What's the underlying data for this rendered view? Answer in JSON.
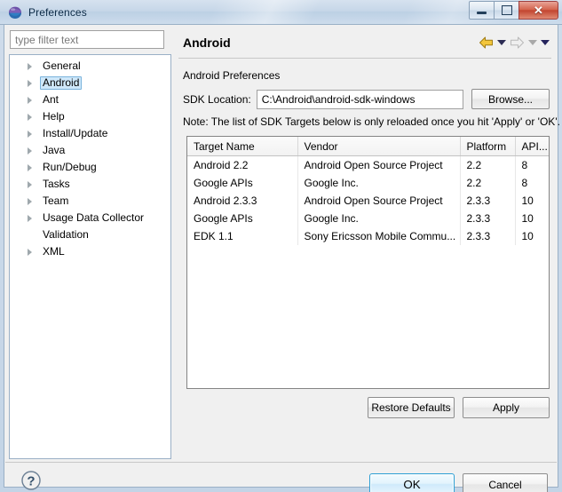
{
  "window": {
    "title": "Preferences",
    "icon": "eclipse-globe-icon",
    "minimize_label": "",
    "restore_label": "",
    "close_label": "✕"
  },
  "sidebar": {
    "filter": {
      "value": "",
      "placeholder": "type filter text"
    },
    "items": [
      {
        "label": "General",
        "expandable": true,
        "selected": false
      },
      {
        "label": "Android",
        "expandable": true,
        "selected": true
      },
      {
        "label": "Ant",
        "expandable": true,
        "selected": false
      },
      {
        "label": "Help",
        "expandable": true,
        "selected": false
      },
      {
        "label": "Install/Update",
        "expandable": true,
        "selected": false
      },
      {
        "label": "Java",
        "expandable": true,
        "selected": false
      },
      {
        "label": "Run/Debug",
        "expandable": true,
        "selected": false
      },
      {
        "label": "Tasks",
        "expandable": true,
        "selected": false
      },
      {
        "label": "Team",
        "expandable": true,
        "selected": false
      },
      {
        "label": "Usage Data Collector",
        "expandable": true,
        "selected": false
      },
      {
        "label": "Validation",
        "expandable": false,
        "selected": false
      },
      {
        "label": "XML",
        "expandable": true,
        "selected": false
      }
    ]
  },
  "content": {
    "page_title": "Android",
    "nav": {
      "back_icon": "back-arrow-icon",
      "back_menu_icon": "chevron-down-icon",
      "forward_icon": "forward-arrow-icon",
      "forward_menu_icon": "chevron-down-icon",
      "view_menu_icon": "chevron-down-icon"
    },
    "section_label": "Android Preferences",
    "sdk": {
      "label": "SDK Location:",
      "value": "C:\\Android\\android-sdk-windows",
      "placeholder": "",
      "browse_label": "Browse..."
    },
    "note": "Note: The list of SDK Targets below is only reloaded once you hit 'Apply' or 'OK'.",
    "table": {
      "columns": [
        "Target Name",
        "Vendor",
        "Platform",
        "API..."
      ],
      "rows": [
        [
          "Android 2.2",
          "Android Open Source Project",
          "2.2",
          "8"
        ],
        [
          "Google APIs",
          "Google Inc.",
          "2.2",
          "8"
        ],
        [
          "Android 2.3.3",
          "Android Open Source Project",
          "2.3.3",
          "10"
        ],
        [
          "Google APIs",
          "Google Inc.",
          "2.3.3",
          "10"
        ],
        [
          "EDK 1.1",
          "Sony Ericsson Mobile Commu...",
          "2.3.3",
          "10"
        ]
      ]
    },
    "restore_defaults_label": "Restore Defaults",
    "apply_label": "Apply"
  },
  "footer": {
    "help_icon": "question-mark-help-icon",
    "ok_label": "OK",
    "cancel_label": "Cancel"
  },
  "colors": {
    "accent_selection": "#cfe8fa",
    "default_button_border": "#2c9fd4",
    "close_button": "#c24530",
    "dialog_background": "#f0f0f0"
  }
}
